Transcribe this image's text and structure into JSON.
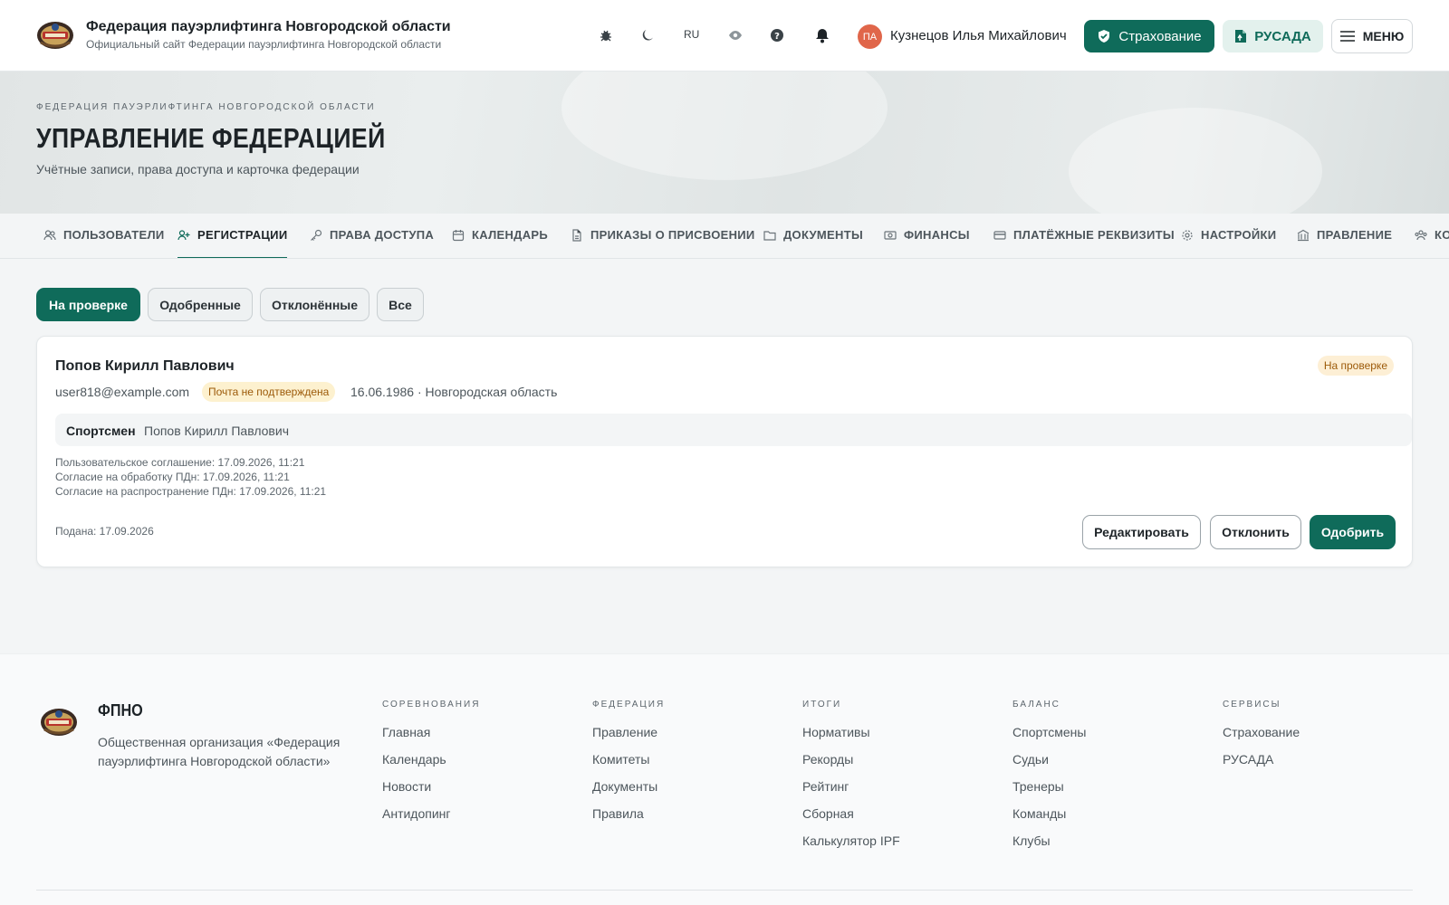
{
  "colors": {
    "accent": "#0f6b5a",
    "accent_soft": "#e3f1ed",
    "warning_bg": "#fdefd5",
    "warning_text": "#9c5a09",
    "avatar": "#e0664a"
  },
  "header": {
    "title": "Федерация пауэрлифтинга Новгородской области",
    "subtitle": "Официальный сайт Федерации пауэрлифтинга Новгородской области",
    "icons": [
      "bug-icon",
      "moon-icon",
      "eye-icon",
      "help-icon",
      "bell-icon"
    ],
    "lang": "RU",
    "user": {
      "initials": "ПА",
      "name": "Кузнецов Илья Михайлович"
    },
    "insurance_label": "Страхование",
    "rusada_label": "РУСАДА",
    "menu_label": "МЕНЮ"
  },
  "hero": {
    "kicker": "ФЕДЕРАЦИЯ ПАУЭРЛИФТИНГА НОВГОРОДСКОЙ ОБЛАСТИ",
    "title": "УПРАВЛЕНИЕ ФЕДЕРАЦИЕЙ",
    "subtitle": "Учётные записи, права доступа и карточка федерации"
  },
  "tabs": [
    {
      "label": "ПОЛЬЗОВАТЕЛИ",
      "icon": "users-icon"
    },
    {
      "label": "РЕГИСТРАЦИИ",
      "icon": "user-plus-icon",
      "active": true
    },
    {
      "label": "ПРАВА ДОСТУПА",
      "icon": "key-icon"
    },
    {
      "label": "КАЛЕНДАРЬ",
      "icon": "calendar-icon"
    },
    {
      "label": "ПРИКАЗЫ О ПРИСВОЕНИИ",
      "icon": "file-icon"
    },
    {
      "label": "ДОКУМЕНТЫ",
      "icon": "folder-icon"
    },
    {
      "label": "ФИНАНСЫ",
      "icon": "money-icon"
    },
    {
      "label": "ПЛАТЁЖНЫЕ РЕКВИЗИТЫ",
      "icon": "card-icon"
    },
    {
      "label": "НАСТРОЙКИ",
      "icon": "gear-icon"
    },
    {
      "label": "ПРАВЛЕНИЕ",
      "icon": "building-icon"
    },
    {
      "label": "КО",
      "icon": "committee-icon"
    }
  ],
  "filters": [
    {
      "label": "На проверке",
      "active": true
    },
    {
      "label": "Одобренные"
    },
    {
      "label": "Отклонённые"
    },
    {
      "label": "Все"
    }
  ],
  "registration": {
    "name": "Попов Кирилл Павлович",
    "status": "На проверке",
    "email": "user818@example.com",
    "email_badge": "Почта не подтверждена",
    "meta": "16.06.1986 · Новгородская область",
    "role_label": "Спортсмен",
    "role_value": "Попов Кирилл Павлович",
    "consents": [
      "Пользовательское соглашение: 17.09.2026, 11:21",
      "Согласие на обработку ПДн: 17.09.2026, 11:21",
      "Согласие на распространение ПДн: 17.09.2026, 11:21"
    ],
    "filed": "Подана: 17.09.2026",
    "edit_label": "Редактировать",
    "reject_label": "Отклонить",
    "approve_label": "Одобрить"
  },
  "footer": {
    "brand": "ФПНО",
    "description": "Общественная организация «Федерация пауэрлифтинга Новгородской области»",
    "columns": [
      {
        "title": "СОРЕВНОВАНИЯ",
        "links": [
          "Главная",
          "Календарь",
          "Новости",
          "Антидопинг"
        ]
      },
      {
        "title": "ФЕДЕРАЦИЯ",
        "links": [
          "Правление",
          "Комитеты",
          "Документы",
          "Правила"
        ]
      },
      {
        "title": "ИТОГИ",
        "links": [
          "Нормативы",
          "Рекорды",
          "Рейтинг",
          "Сборная",
          "Калькулятор IPF"
        ]
      },
      {
        "title": "БАЛАНС",
        "links": [
          "Спортсмены",
          "Судьи",
          "Тренеры",
          "Команды",
          "Клубы"
        ]
      },
      {
        "title": "СЕРВИСЫ",
        "links": [
          "Страхование",
          "РУСАДА"
        ]
      }
    ]
  }
}
